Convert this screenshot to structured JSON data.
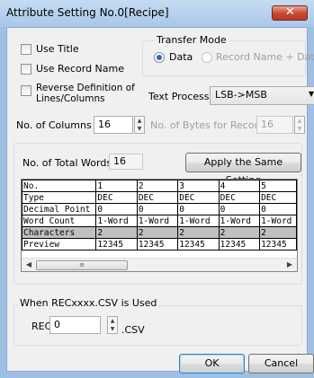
{
  "window": {
    "title": "Attribute Setting No.0[Recipe]",
    "close_symbol": "✕"
  },
  "options": {
    "use_title": "Use Title",
    "use_record_name": "Use Record Name",
    "reverse_line1": "Reverse Definition of",
    "reverse_line2": "Lines/Columns"
  },
  "transfer_mode": {
    "label": "Transfer Mode",
    "data": "Data",
    "record_name_data": "Record Name + Data",
    "selected": "Data"
  },
  "text_process": {
    "label": "Text Process",
    "value": "LSB->MSB"
  },
  "columns": {
    "label": "No. of Columns",
    "value": "16"
  },
  "bytes_per_record": {
    "label": "No. of Bytes for Record",
    "value": "16"
  },
  "total_words": {
    "label": "No. of Total Words",
    "value": "16"
  },
  "apply_button": "Apply the Same Setting",
  "grid": {
    "headers": [
      "No.",
      "1",
      "2",
      "3",
      "4",
      "5"
    ],
    "rows": [
      {
        "label": "Type",
        "cells": [
          "DEC",
          "DEC",
          "DEC",
          "DEC",
          "DEC"
        ]
      },
      {
        "label": "Decimal Point",
        "cells": [
          "0",
          "0",
          "0",
          "0",
          "0"
        ]
      },
      {
        "label": "Word Count",
        "cells": [
          "1-Word",
          "1-Word",
          "1-Word",
          "1-Word",
          "1-Word"
        ]
      },
      {
        "label": "Characters",
        "cells": [
          "2",
          "2",
          "2",
          "2",
          "2"
        ]
      },
      {
        "label": "Preview",
        "cells": [
          "12345",
          "12345",
          "12345",
          "12345",
          "12345"
        ]
      }
    ]
  },
  "rec_group": {
    "label": "When RECxxxx.CSV is Used",
    "rec_label": "REC",
    "rec_value": "0",
    "suffix": ".CSV"
  },
  "buttons": {
    "ok": "OK",
    "cancel": "Cancel"
  }
}
